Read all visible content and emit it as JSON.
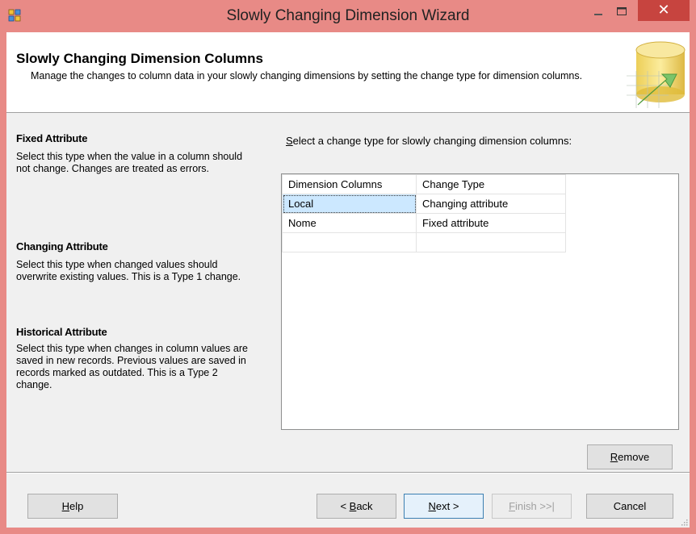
{
  "window": {
    "title": "Slowly Changing Dimension Wizard",
    "controls": {
      "minimize": "–",
      "maximize": "□",
      "close": "✕"
    }
  },
  "header": {
    "title": "Slowly Changing Dimension Columns",
    "description": "Manage the changes to column data in your slowly changing dimensions by setting the change type for dimension columns."
  },
  "help_sections": [
    {
      "title": "Fixed Attribute",
      "description": "Select this type when the value in a column should not change. Changes are treated as errors."
    },
    {
      "title": "Changing Attribute",
      "description": "Select this type when changed values should overwrite existing values. This is a Type 1 change."
    },
    {
      "title": "Historical Attribute",
      "description": "Select this type when changes in column values are saved in new records. Previous values are saved in records marked as outdated. This is a Type 2 change."
    }
  ],
  "grid": {
    "prompt_mnemonic": "S",
    "prompt_rest": "elect a change type for slowly changing dimension columns:",
    "headers": [
      "Dimension Columns",
      "Change Type"
    ],
    "rows": [
      [
        "Local",
        "Changing attribute"
      ],
      [
        "Nome",
        "Fixed attribute"
      ],
      [
        "",
        ""
      ]
    ]
  },
  "buttons": {
    "remove": {
      "mnemonic": "R",
      "rest": "emove"
    },
    "help": {
      "mnemonic": "H",
      "rest": "elp"
    },
    "back": {
      "pre": "< ",
      "mnemonic": "B",
      "rest": "ack"
    },
    "next": {
      "mnemonic": "N",
      "rest": "ext >"
    },
    "finish": {
      "mnemonic": "F",
      "rest": "inish >>|"
    },
    "cancel": "Cancel"
  },
  "colors": {
    "titlebar": "#e88a86",
    "close_button": "#c7443f",
    "selection": "#cce8ff",
    "dialog_background": "#f0f0f0"
  },
  "icons": [
    "app-icon",
    "minimize-icon",
    "maximize-icon",
    "close-icon",
    "wizard-header-graphic",
    "resize-grip-icon"
  ]
}
